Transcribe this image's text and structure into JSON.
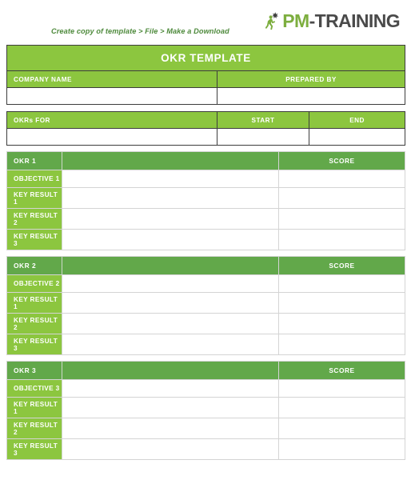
{
  "topbar": {
    "subtitle": "Create copy of template > File > Make a Download",
    "logo": {
      "mark": "climber-figure-icon",
      "primary": "PM",
      "secondary": "-TRAINING"
    }
  },
  "colors": {
    "accent_light": "#8CC63F",
    "accent_dark": "#62A84A",
    "subtitle_green": "#4e8a3c",
    "logo_gray": "#4a4a4a"
  },
  "info_table": {
    "title": "OKR TEMPLATE",
    "row1": {
      "company_name_label": "COMPANY NAME",
      "company_name_value": "",
      "prepared_by_label": "PREPARED BY",
      "prepared_by_value": ""
    },
    "row2": {
      "okrs_for_label": "OKRs FOR",
      "okrs_for_value": "",
      "start_label": "START",
      "start_value": "",
      "end_label": "END",
      "end_value": ""
    }
  },
  "okr_blocks": [
    {
      "tag": "OKR 1",
      "header_value": "",
      "score_label": "SCORE",
      "rows": [
        {
          "label": "OBJECTIVE 1",
          "value": "",
          "score": ""
        },
        {
          "label": "KEY RESULT 1",
          "value": "",
          "score": ""
        },
        {
          "label": "KEY RESULT 2",
          "value": "",
          "score": ""
        },
        {
          "label": "KEY RESULT 3",
          "value": "",
          "score": ""
        }
      ]
    },
    {
      "tag": "OKR 2",
      "header_value": "",
      "score_label": "SCORE",
      "rows": [
        {
          "label": "OBJECTIVE 2",
          "value": "",
          "score": ""
        },
        {
          "label": "KEY RESULT 1",
          "value": "",
          "score": ""
        },
        {
          "label": "KEY RESULT 2",
          "value": "",
          "score": ""
        },
        {
          "label": "KEY RESULT 3",
          "value": "",
          "score": ""
        }
      ]
    },
    {
      "tag": "OKR 3",
      "header_value": "",
      "score_label": "SCORE",
      "rows": [
        {
          "label": "OBJECTIVE 3",
          "value": "",
          "score": ""
        },
        {
          "label": "KEY RESULT 1",
          "value": "",
          "score": ""
        },
        {
          "label": "KEY RESULT 2",
          "value": "",
          "score": ""
        },
        {
          "label": "KEY RESULT 3",
          "value": "",
          "score": ""
        }
      ]
    }
  ]
}
